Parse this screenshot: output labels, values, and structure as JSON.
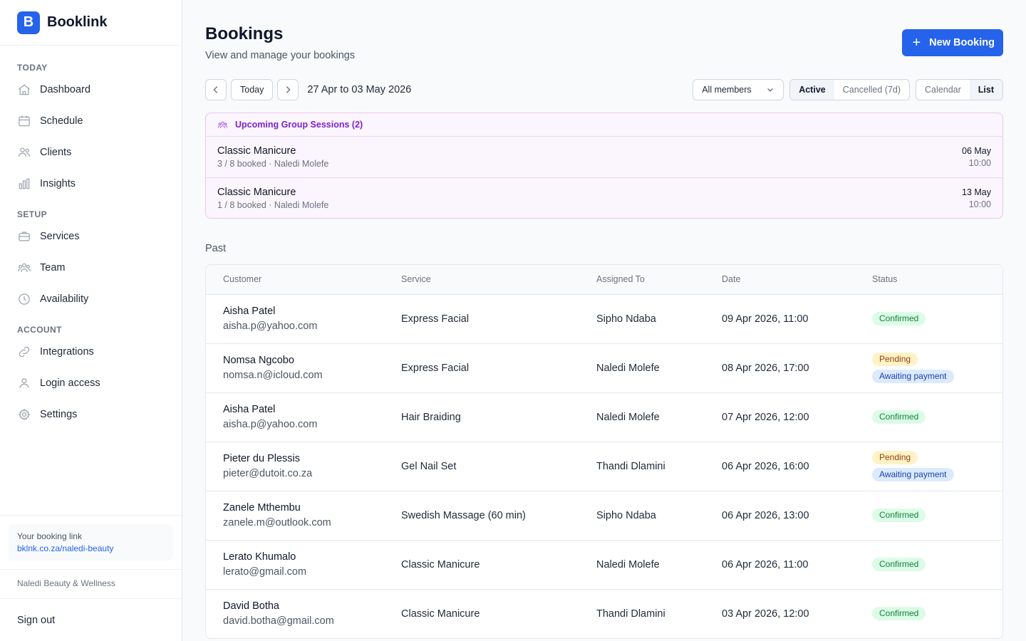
{
  "brand": {
    "logo_letter": "B",
    "name": "Booklink"
  },
  "sidebar": {
    "sections": [
      {
        "label": "TODAY",
        "items": [
          {
            "label": "Dashboard",
            "icon": "home-icon"
          },
          {
            "label": "Schedule",
            "icon": "calendar-icon"
          },
          {
            "label": "Clients",
            "icon": "users-icon"
          },
          {
            "label": "Insights",
            "icon": "bar-chart-icon"
          }
        ]
      },
      {
        "label": "SETUP",
        "items": [
          {
            "label": "Services",
            "icon": "briefcase-icon"
          },
          {
            "label": "Team",
            "icon": "team-icon"
          },
          {
            "label": "Availability",
            "icon": "clock-icon"
          }
        ]
      },
      {
        "label": "ACCOUNT",
        "items": [
          {
            "label": "Integrations",
            "icon": "link-icon"
          },
          {
            "label": "Login access",
            "icon": "user-icon"
          },
          {
            "label": "Settings",
            "icon": "gear-icon"
          }
        ]
      }
    ],
    "booking_link_label": "Your booking link",
    "booking_link_url": "bklnk.co.za/naledi-beauty",
    "org_name": "Naledi Beauty & Wellness",
    "sign_out": "Sign out"
  },
  "header": {
    "title": "Bookings",
    "subtitle": "View and manage your bookings",
    "new_button": "New Booking"
  },
  "toolbar": {
    "today": "Today",
    "date_range": "27 Apr to 03 May 2026",
    "member_filter": "All members",
    "status_tabs": [
      {
        "label": "Active",
        "active": true
      },
      {
        "label": "Cancelled (7d)",
        "active": false
      }
    ],
    "view_tabs": [
      {
        "label": "Calendar",
        "active": false
      },
      {
        "label": "List",
        "active": true
      }
    ]
  },
  "group_sessions": {
    "heading": "Upcoming Group Sessions (2)",
    "sessions": [
      {
        "name": "Classic Manicure",
        "meta": "3 / 8 booked · Naledi Molefe",
        "date": "06 May",
        "time": "10:00"
      },
      {
        "name": "Classic Manicure",
        "meta": "1 / 8 booked · Naledi Molefe",
        "date": "13 May",
        "time": "10:00"
      }
    ]
  },
  "past": {
    "label": "Past",
    "columns": [
      "Customer",
      "Service",
      "Assigned To",
      "Date",
      "Status"
    ],
    "rows": [
      {
        "name": "Aisha Patel",
        "email": "aisha.p@yahoo.com",
        "service": "Express Facial",
        "assigned": "Sipho Ndaba",
        "date": "09 Apr 2026, 11:00",
        "statuses": [
          {
            "label": "Confirmed",
            "kind": "confirmed"
          }
        ]
      },
      {
        "name": "Nomsa Ngcobo",
        "email": "nomsa.n@icloud.com",
        "service": "Express Facial",
        "assigned": "Naledi Molefe",
        "date": "08 Apr 2026, 17:00",
        "statuses": [
          {
            "label": "Pending",
            "kind": "pending"
          },
          {
            "label": "Awaiting payment",
            "kind": "awaiting"
          }
        ]
      },
      {
        "name": "Aisha Patel",
        "email": "aisha.p@yahoo.com",
        "service": "Hair Braiding",
        "assigned": "Naledi Molefe",
        "date": "07 Apr 2026, 12:00",
        "statuses": [
          {
            "label": "Confirmed",
            "kind": "confirmed"
          }
        ]
      },
      {
        "name": "Pieter du Plessis",
        "email": "pieter@dutoit.co.za",
        "service": "Gel Nail Set",
        "assigned": "Thandi Dlamini",
        "date": "06 Apr 2026, 16:00",
        "statuses": [
          {
            "label": "Pending",
            "kind": "pending"
          },
          {
            "label": "Awaiting payment",
            "kind": "awaiting"
          }
        ]
      },
      {
        "name": "Zanele Mthembu",
        "email": "zanele.m@outlook.com",
        "service": "Swedish Massage (60 min)",
        "assigned": "Sipho Ndaba",
        "date": "06 Apr 2026, 13:00",
        "statuses": [
          {
            "label": "Confirmed",
            "kind": "confirmed"
          }
        ]
      },
      {
        "name": "Lerato Khumalo",
        "email": "lerato@gmail.com",
        "service": "Classic Manicure",
        "assigned": "Naledi Molefe",
        "date": "06 Apr 2026, 11:00",
        "statuses": [
          {
            "label": "Confirmed",
            "kind": "confirmed"
          }
        ]
      },
      {
        "name": "David Botha",
        "email": "david.botha@gmail.com",
        "service": "Classic Manicure",
        "assigned": "Thandi Dlamini",
        "date": "03 Apr 2026, 12:00",
        "statuses": [
          {
            "label": "Confirmed",
            "kind": "confirmed"
          }
        ]
      }
    ]
  },
  "colors": {
    "accent": "#2563eb",
    "group_accent": "#7e22ce",
    "confirmed": "#15803d",
    "pending": "#92400e",
    "awaiting": "#1e40af"
  }
}
